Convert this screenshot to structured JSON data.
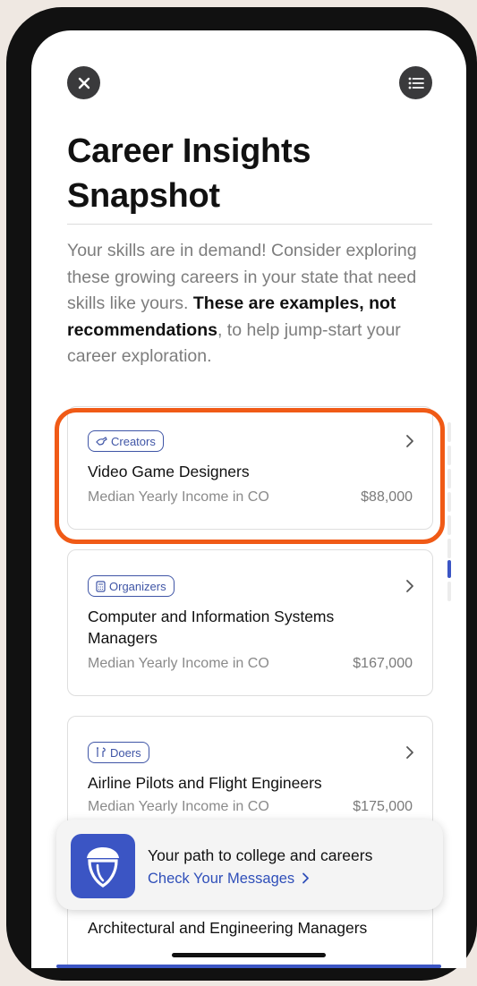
{
  "header": {
    "close_icon": "close-icon",
    "menu_icon": "list-icon",
    "title": "Career Insights Snapshot"
  },
  "intro": {
    "part1": "Your skills are in demand! Consider exploring these growing careers in your state that need skills like yours. ",
    "bold": "These are examples, not recommendations",
    "part2": ", to help jump-start your career exploration."
  },
  "careers": [
    {
      "category": "Creators",
      "category_icon": "brush-icon",
      "name": "Video Game Designers",
      "income_label": "Median Yearly Income in CO",
      "income": "$88,000"
    },
    {
      "category": "Organizers",
      "category_icon": "calculator-icon",
      "name": "Computer and Information Systems Managers",
      "income_label": "Median Yearly Income in CO",
      "income": "$167,000"
    },
    {
      "category": "Doers",
      "category_icon": "tools-icon",
      "name": "Airline Pilots and Flight Engineers",
      "income_label": "Median Yearly Income in CO",
      "income": "$175,000"
    },
    {
      "name": "Architectural and Engineering Managers"
    }
  ],
  "toast": {
    "logo_icon": "acorn-shield-icon",
    "title": "Your path to college and careers",
    "link": "Check Your Messages"
  },
  "colors": {
    "accent": "#3f55a6",
    "highlight": "#f05a16",
    "toast_logo": "#3b55c4"
  }
}
